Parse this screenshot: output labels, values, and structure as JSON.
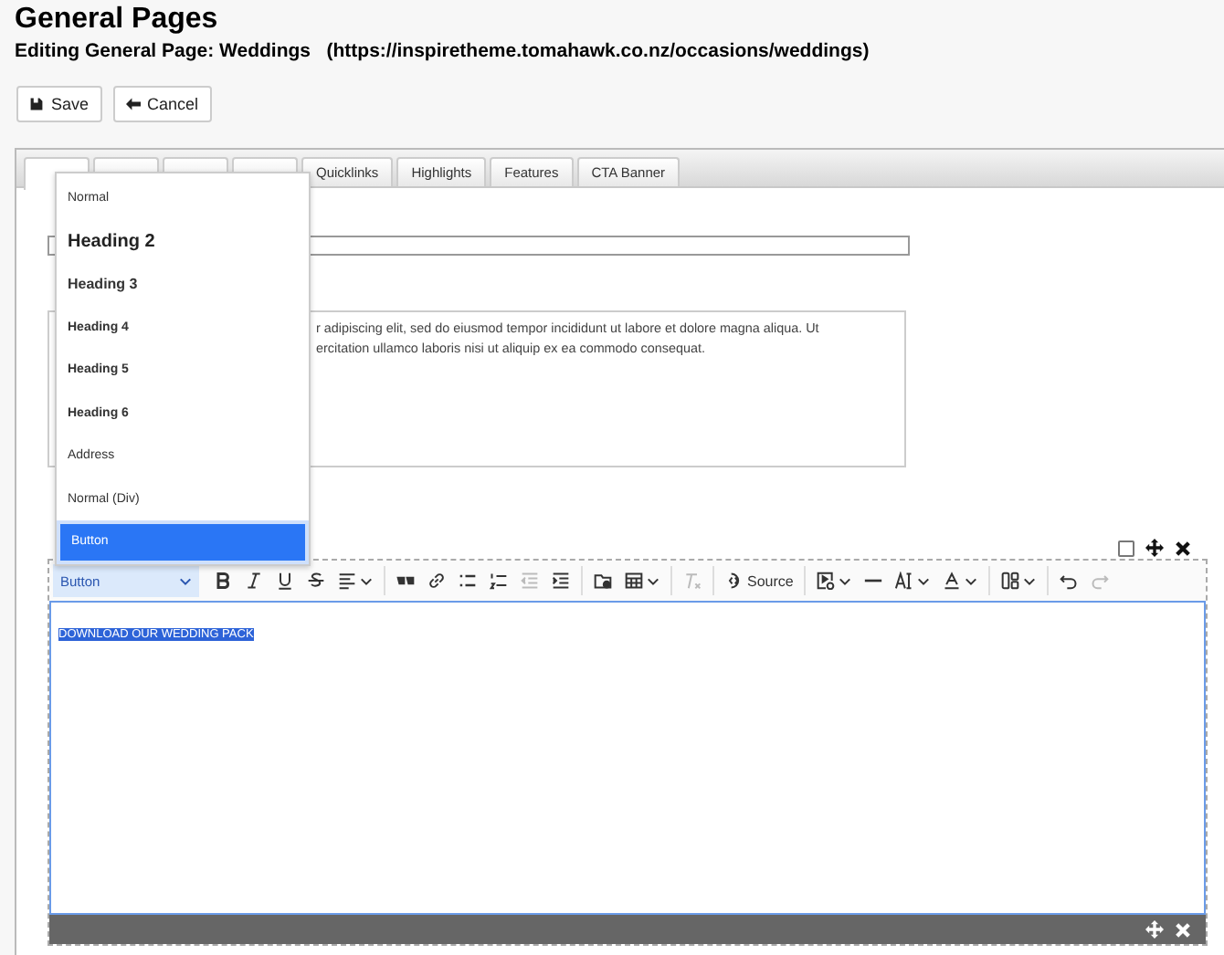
{
  "header": {
    "title": "General Pages",
    "subtitle": "Editing General Page: Weddings   (https://inspiretheme.tomahawk.co.nz/occasions/weddings)"
  },
  "actions": [
    {
      "kind": "save",
      "label": "Save"
    },
    {
      "kind": "cancel",
      "label": "Cancel"
    }
  ],
  "tabs": [
    {
      "selected": true
    },
    {
      "selected": false
    },
    {
      "selected": false
    },
    {
      "selected": false
    },
    {
      "label": "Quicklinks",
      "selected": false
    },
    {
      "label": "Highlights",
      "selected": false
    },
    {
      "label": "Features",
      "selected": false
    },
    {
      "label": "CTA Banner",
      "selected": false
    }
  ],
  "form": {
    "block_checkbox": {
      "checked": false
    },
    "intro_lines": [
      "r adipiscing elit, sed do eiusmod tempor incididunt ut labore et dolore magna aliqua. Ut",
      "ercitation ullamco laboris nisi ut aliquip ex ea commodo consequat."
    ]
  },
  "style_menu": [
    {
      "label": "Normal",
      "kind": "p",
      "selected": false
    },
    {
      "label": "Heading 2",
      "kind": "h2",
      "selected": false
    },
    {
      "label": "Heading 3",
      "kind": "h3",
      "selected": false
    },
    {
      "label": "Heading 4",
      "kind": "h4",
      "selected": false
    },
    {
      "label": "Heading 5",
      "kind": "h5",
      "selected": false
    },
    {
      "label": "Heading 6",
      "kind": "h6",
      "selected": false
    },
    {
      "label": "Address",
      "kind": "p",
      "selected": false
    },
    {
      "label": "Normal (Div)",
      "kind": "p",
      "selected": false
    },
    {
      "label": "Button",
      "kind": "p",
      "selected": true
    }
  ],
  "editor": {
    "style_value": "Button",
    "content": "DOWNLOAD OUR WEDDING PACK",
    "tools": [
      {
        "kind": "bold",
        "disabled": false
      },
      {
        "kind": "italic",
        "disabled": false
      },
      {
        "kind": "underline",
        "disabled": false
      },
      {
        "kind": "strike",
        "disabled": false
      },
      {
        "kind": "align",
        "disabled": false
      },
      {
        "kind": "separator"
      },
      {
        "kind": "quote",
        "disabled": false
      },
      {
        "kind": "link",
        "disabled": false
      },
      {
        "kind": "bullets",
        "disabled": false
      },
      {
        "kind": "numbers",
        "disabled": false
      },
      {
        "kind": "outdent",
        "disabled": true
      },
      {
        "kind": "indent",
        "disabled": false
      },
      {
        "kind": "separator"
      },
      {
        "kind": "folder",
        "disabled": false
      },
      {
        "kind": "table",
        "disabled": false
      },
      {
        "kind": "separator"
      },
      {
        "kind": "clear",
        "disabled": true
      },
      {
        "kind": "separator"
      },
      {
        "kind": "source",
        "label": "Source",
        "disabled": false
      },
      {
        "kind": "separator"
      },
      {
        "kind": "embed",
        "disabled": false
      },
      {
        "kind": "rule",
        "disabled": false
      },
      {
        "kind": "fontsize",
        "disabled": false
      },
      {
        "kind": "fontcolor",
        "disabled": false
      },
      {
        "kind": "separator"
      },
      {
        "kind": "layout",
        "disabled": false
      },
      {
        "kind": "separator"
      },
      {
        "kind": "undo",
        "disabled": false
      },
      {
        "kind": "redo",
        "disabled": true
      }
    ]
  }
}
